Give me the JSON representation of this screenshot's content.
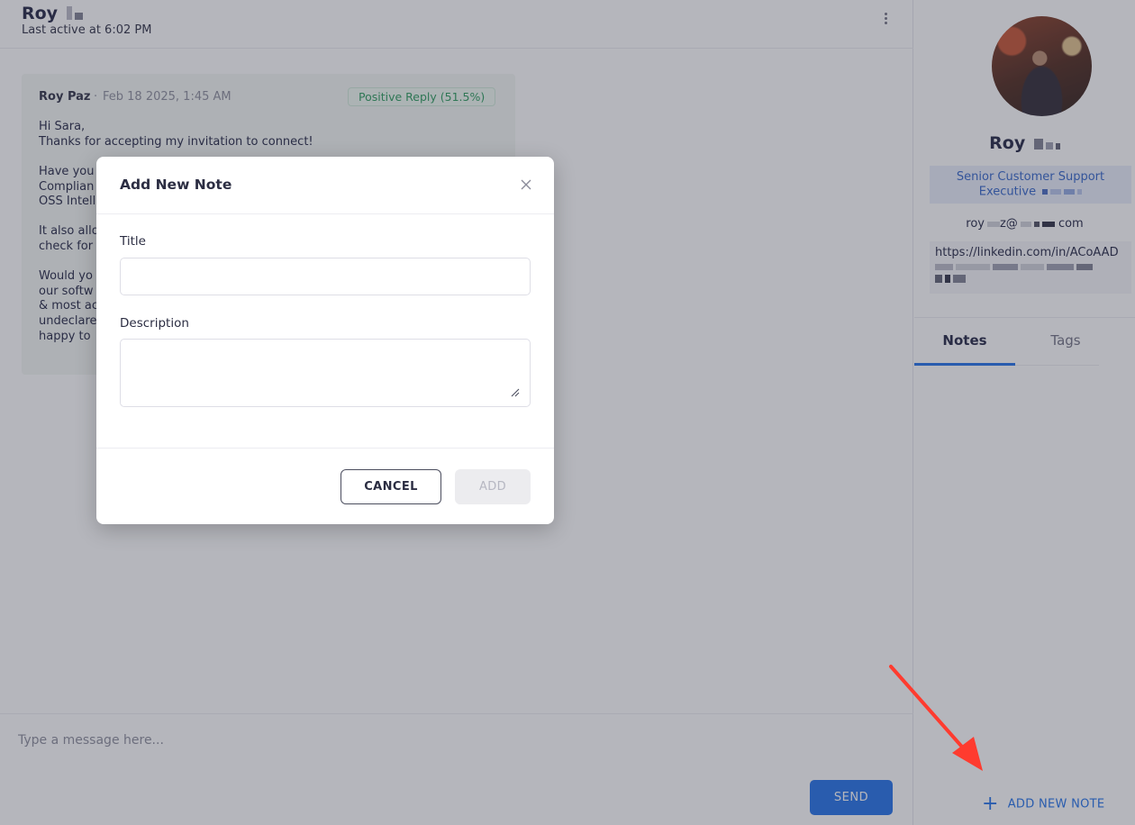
{
  "header": {
    "contact_name": "Roy",
    "last_active": "Last active at 6:02 PM"
  },
  "message": {
    "sender": "Roy Paz",
    "separator": "·",
    "date": "Feb 18 2025, 1:45 AM",
    "sentiment": "Positive Reply (51.5%)",
    "lines": [
      "Hi Sara,",
      "Thanks for accepting my invitation to connect!",
      "Have you",
      "Complian",
      "OSS Intell",
      "It also allo",
      "check for",
      "Would yo",
      "our softw",
      "& most ac",
      "undeclare",
      "happy to"
    ]
  },
  "composer": {
    "placeholder": "Type a message here...",
    "send_label": "SEND"
  },
  "profile": {
    "name": "Roy",
    "role": "Senior Customer Support Executive",
    "email_user": "roy",
    "email_at": "z@",
    "email_tld": "com",
    "linkedin": "https://linkedin.com/in/ACoAAD",
    "tabs": [
      {
        "label": "Notes",
        "active": true
      },
      {
        "label": "Tags",
        "active": false
      }
    ],
    "add_note_label": "ADD NEW NOTE"
  },
  "modal": {
    "title": "Add New Note",
    "title_label": "Title",
    "title_value": "",
    "description_label": "Description",
    "description_value": "",
    "cancel_label": "CANCEL",
    "add_label": "ADD"
  },
  "colors": {
    "accent": "#1d6ee8",
    "positive": "#279a5a",
    "annotation_arrow": "#ff3b2f"
  }
}
